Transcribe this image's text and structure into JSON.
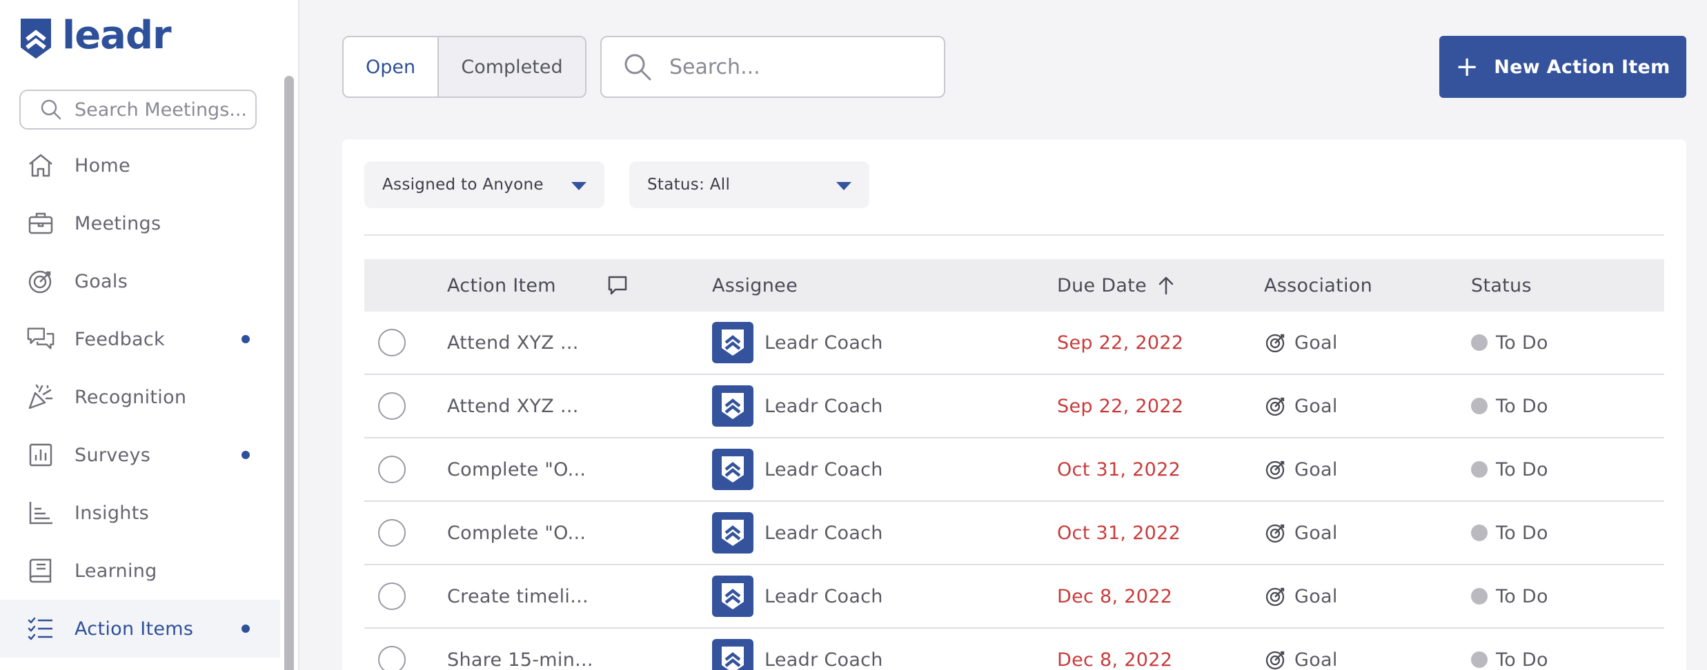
{
  "brand": {
    "name": "leadr",
    "color": "#2e4f99"
  },
  "sidebar": {
    "search_placeholder": "Search Meetings...",
    "items": [
      {
        "label": "Home",
        "icon": "home-icon",
        "dot": false,
        "active": false
      },
      {
        "label": "Meetings",
        "icon": "briefcase-icon",
        "dot": false,
        "active": false
      },
      {
        "label": "Goals",
        "icon": "target-icon",
        "dot": false,
        "active": false
      },
      {
        "label": "Feedback",
        "icon": "chat-bubbles-icon",
        "dot": true,
        "active": false
      },
      {
        "label": "Recognition",
        "icon": "party-popper-icon",
        "dot": false,
        "active": false
      },
      {
        "label": "Surveys",
        "icon": "bar-chart-icon",
        "dot": true,
        "active": false
      },
      {
        "label": "Insights",
        "icon": "line-chart-icon",
        "dot": false,
        "active": false
      },
      {
        "label": "Learning",
        "icon": "book-icon",
        "dot": false,
        "active": false
      },
      {
        "label": "Action Items",
        "icon": "checklist-icon",
        "dot": true,
        "active": true
      }
    ]
  },
  "toolbar": {
    "tab_open": "Open",
    "tab_completed": "Completed",
    "search_placeholder": "Search...",
    "new_button_label": "New Action Item"
  },
  "filters": {
    "assigned": "Assigned to Anyone",
    "status": "Status: All"
  },
  "table": {
    "columns": {
      "action_item": "Action Item",
      "assignee": "Assignee",
      "due_date": "Due Date",
      "association": "Association",
      "status": "Status"
    },
    "rows": [
      {
        "action_item": "Attend XYZ ...",
        "assignee": "Leadr Coach",
        "due_date": "Sep 22, 2022",
        "association": "Goal",
        "status": "To Do"
      },
      {
        "action_item": "Attend XYZ ...",
        "assignee": "Leadr Coach",
        "due_date": "Sep 22, 2022",
        "association": "Goal",
        "status": "To Do"
      },
      {
        "action_item": "Complete \"O...",
        "assignee": "Leadr Coach",
        "due_date": "Oct 31, 2022",
        "association": "Goal",
        "status": "To Do"
      },
      {
        "action_item": "Complete \"O...",
        "assignee": "Leadr Coach",
        "due_date": "Oct 31, 2022",
        "association": "Goal",
        "status": "To Do"
      },
      {
        "action_item": "Create timeli...",
        "assignee": "Leadr Coach",
        "due_date": "Dec 8, 2022",
        "association": "Goal",
        "status": "To Do"
      },
      {
        "action_item": "Share 15-min...",
        "assignee": "Leadr Coach",
        "due_date": "Dec 8, 2022",
        "association": "Goal",
        "status": "To Do"
      }
    ]
  },
  "colors": {
    "accent": "#34539c",
    "overdue": "#c93a3a",
    "status_todo": "#b9b9bf"
  }
}
